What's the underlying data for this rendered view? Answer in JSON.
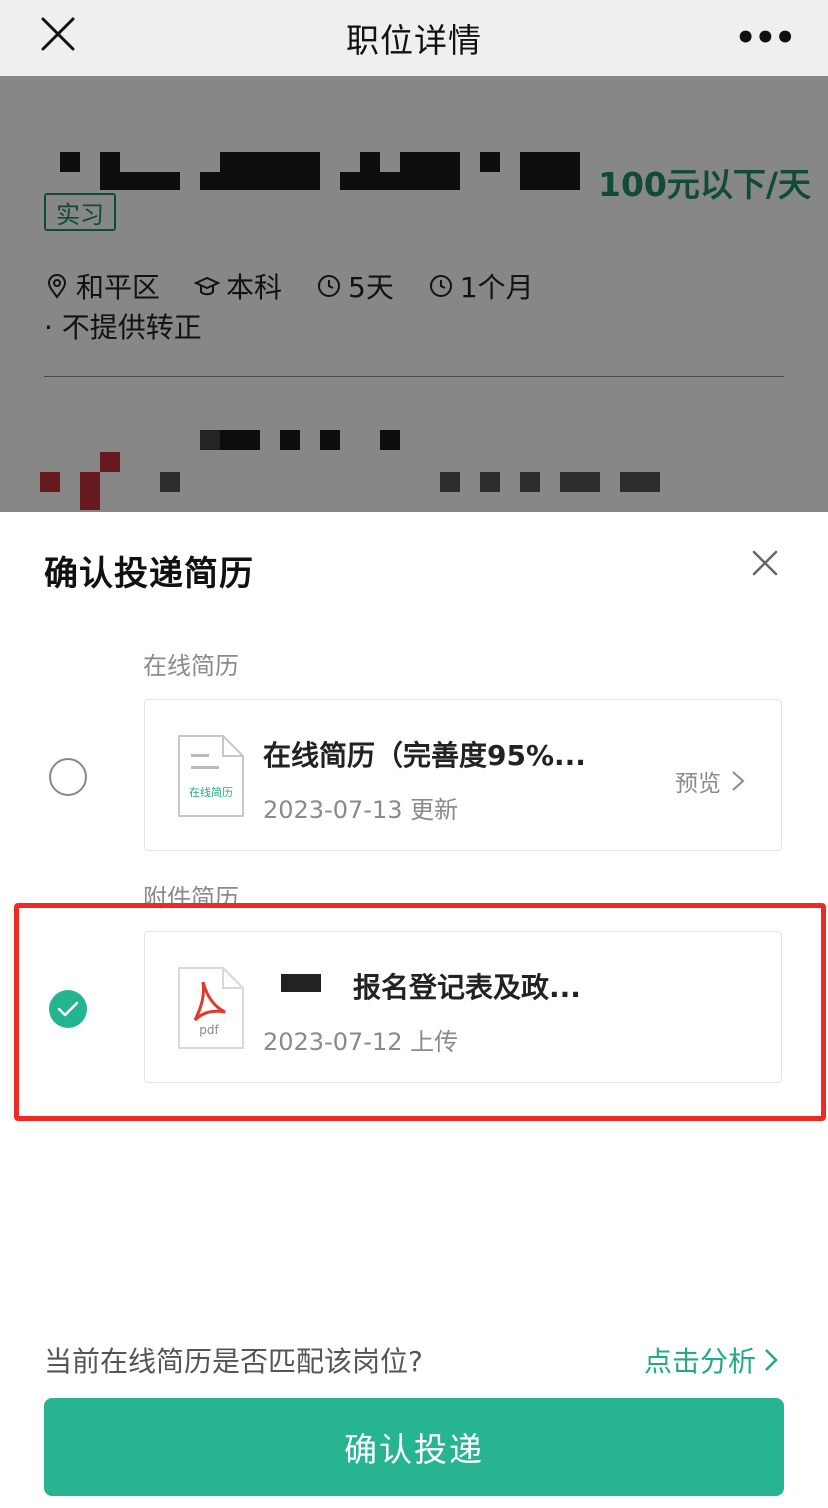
{
  "navbar": {
    "title": "职位详情",
    "close_icon": "close-icon",
    "more_label": "•••"
  },
  "job": {
    "salary": "100元以下/天",
    "tag": "实习",
    "meta": [
      {
        "icon": "location-icon",
        "text": "和平区"
      },
      {
        "icon": "graduation-cap-icon",
        "text": "本科"
      },
      {
        "icon": "clock-icon",
        "text": "5天"
      },
      {
        "icon": "clock-icon",
        "text": "1个月"
      }
    ],
    "meta2": "· 不提供转正"
  },
  "sheet": {
    "title": "确认投递简历",
    "online_section_label": "在线简历",
    "online_card": {
      "name": "在线简历（完善度95%...",
      "date": "2023-07-13 更新",
      "icon_text": "在线简历",
      "preview_label": "预览",
      "selected": false
    },
    "attachment_section_label": "附件简历",
    "attachment_card": {
      "name": "报名登记表及政...",
      "date": "2023-07-12 上传",
      "icon_text": "pdf",
      "selected": true
    },
    "match_question": "当前在线简历是否匹配该岗位?",
    "analyze_label": "点击分析",
    "submit_label": "确认投递"
  },
  "colors": {
    "accent": "#26b590",
    "salary": "#1f8f6e",
    "highlight": "#ee2a22"
  }
}
